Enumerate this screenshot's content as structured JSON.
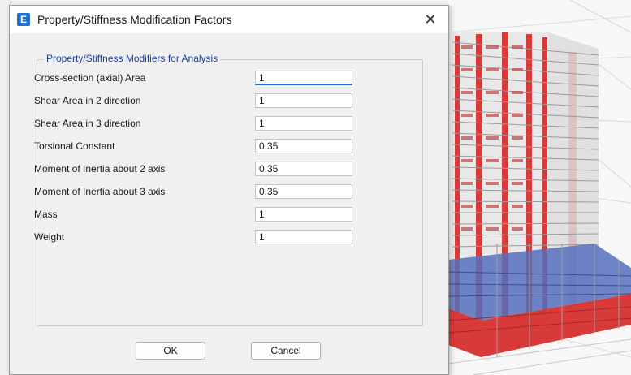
{
  "dialog": {
    "app_icon": "E",
    "title": "Property/Stiffness Modification Factors",
    "close_glyph": "✕",
    "group_title": "Property/Stiffness Modifiers for Analysis",
    "rows": [
      {
        "label": "Cross-section (axial) Area",
        "value": "1"
      },
      {
        "label": "Shear Area in 2 direction",
        "value": "1"
      },
      {
        "label": "Shear Area in 3 direction",
        "value": "1"
      },
      {
        "label": "Torsional Constant",
        "value": "0.35"
      },
      {
        "label": "Moment of Inertia about 2 axis",
        "value": "0.35"
      },
      {
        "label": "Moment of Inertia about 3 axis",
        "value": "0.35"
      },
      {
        "label": "Mass",
        "value": "1"
      },
      {
        "label": "Weight",
        "value": "1"
      }
    ],
    "ok_label": "OK",
    "cancel_label": "Cancel"
  },
  "colors": {
    "accent": "#1f6fc8",
    "group_title": "#1e3f9a",
    "model_frame": "#b8b8b8",
    "model_red": "#d83a3a",
    "model_blue": "#4a66b8"
  }
}
